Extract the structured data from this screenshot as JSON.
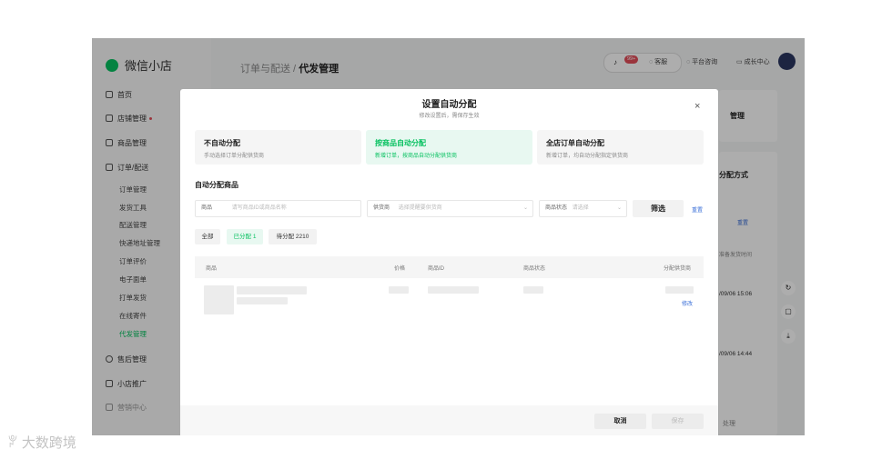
{
  "app": {
    "logo_text": "微信小店",
    "breadcrumb_parent": "订单与配送 /",
    "breadcrumb_current": "代发管理",
    "badge_count": "99+",
    "header_links": {
      "service": "客服",
      "platform": "平台咨询",
      "growth": "成长中心"
    },
    "bg_right_button": "管理",
    "bg_section_title": "分配方式",
    "bg_reset": "重置",
    "bg_text": "准备发货时间",
    "bg_time1": "/09/06 15:06",
    "bg_time2": "/09/06 14:44",
    "bg_footer_action": "处理"
  },
  "sidebar": {
    "home": "首页",
    "shop": "店铺管理",
    "products": "商品管理",
    "orders": "订单/配送",
    "order_subitems": [
      "订单管理",
      "发货工具",
      "配送管理",
      "快递地址管理",
      "订单评价",
      "电子面单",
      "打单发货",
      "在线寄件",
      "代发管理"
    ],
    "after_sales": "售后管理",
    "promotion": "小店推广",
    "marketing": "营销中心"
  },
  "modal": {
    "title": "设置自动分配",
    "subtitle": "修改设置后，需保存生效",
    "close": "×",
    "options": [
      {
        "title": "不自动分配",
        "desc": "手动选择订单分配供货商"
      },
      {
        "title": "按商品自动分配",
        "desc": "新增订单，按商品自动分配供货商"
      },
      {
        "title": "全店订单自动分配",
        "desc": "新增订单，均自动分配指定供货商"
      }
    ],
    "section_title": "自动分配商品",
    "filter": {
      "product_label": "商品",
      "product_placeholder": "请写商品ID或商品名称",
      "supplier_label": "供货商",
      "supplier_placeholder": "选择提醒要供货商",
      "status_label": "商品状态",
      "status_placeholder": "请选择",
      "filter_button": "筛选",
      "reset_link": "重置"
    },
    "tabs": [
      "全部",
      "已分配 1",
      "待分配 2210"
    ],
    "table": {
      "headers": [
        "商品",
        "价格",
        "商品ID",
        "商品状态",
        "分配供货商"
      ],
      "row_action": "修改"
    },
    "footer": {
      "cancel": "取消",
      "save": "保存"
    }
  },
  "watermark": "大数跨境",
  "colors": {
    "accent": "#07c160",
    "badge": "#e34d59"
  }
}
